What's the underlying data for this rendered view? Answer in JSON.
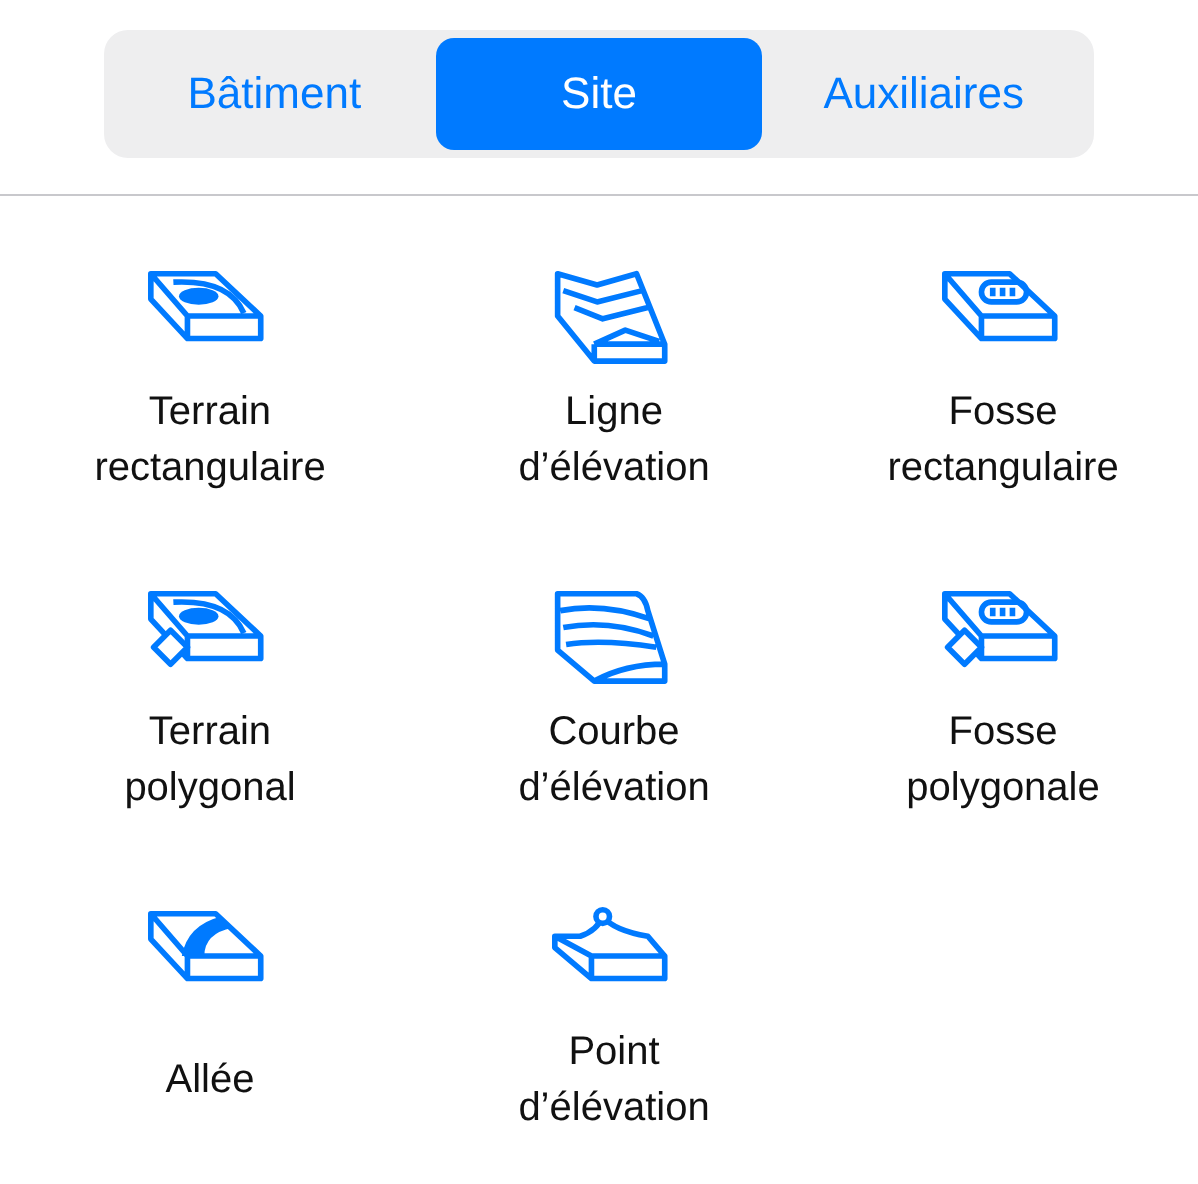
{
  "tabs": [
    {
      "label": "Bâtiment",
      "selected": false
    },
    {
      "label": "Site",
      "selected": true
    },
    {
      "label": "Auxiliaires",
      "selected": false
    }
  ],
  "items": [
    {
      "kind": "terrain-rect",
      "label": "Terrain rectangulaire"
    },
    {
      "kind": "elevation-line",
      "label": "Ligne d’élévation"
    },
    {
      "kind": "pit-rect",
      "label": "Fosse rectangulaire"
    },
    {
      "kind": "terrain-poly",
      "label": "Terrain polygonal"
    },
    {
      "kind": "elevation-curve",
      "label": "Courbe d’élévation"
    },
    {
      "kind": "pit-poly",
      "label": "Fosse polygonale"
    },
    {
      "kind": "path",
      "label": "Allée"
    },
    {
      "kind": "elevation-point",
      "label": "Point d’élévation"
    }
  ]
}
